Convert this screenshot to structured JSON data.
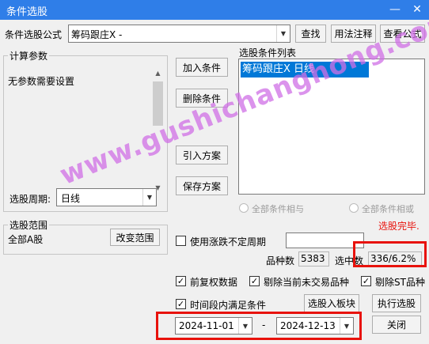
{
  "window": {
    "title": "条件选股",
    "minimize_glyph": "—",
    "close_glyph": "✕"
  },
  "formula": {
    "label": "条件选股公式",
    "value": "筹码跟庄X  -",
    "buttons": {
      "find": "查找",
      "usage": "用法注释",
      "view": "查看公式"
    }
  },
  "params": {
    "group_label": "计算参数",
    "text": "无参数需要设置",
    "period_label": "选股周期:",
    "period_value": "日线"
  },
  "middle_buttons": {
    "add": "加入条件",
    "delete": "删除条件",
    "import": "引入方案",
    "save": "保存方案"
  },
  "conditions": {
    "label": "选股条件列表",
    "items": [
      "筹码跟庄X  日线"
    ],
    "radio_and": "全部条件相与",
    "radio_or": "全部条件相或",
    "status": "选股完毕."
  },
  "range": {
    "group_label": "选股范围",
    "value": "全部A股",
    "change_button": "改变范围"
  },
  "options": {
    "limit_up": "使用涨跌不定周期",
    "count_label": "品种数",
    "count_value": "5383",
    "selected_label": "选中数",
    "selected_value": "336/6.2%",
    "fq": "前复权数据",
    "exclude_untraded": "剔除当前未交易品种",
    "exclude_st": "剔除ST品种",
    "period_satisfy": "时间段内满足条件",
    "select_to_block": "选股入板块",
    "execute": "执行选股",
    "date_from": "2024-11-01",
    "date_sep": "-",
    "date_to": "2024-12-13",
    "close": "关闭"
  },
  "watermark": "www.gushichanghong.com",
  "colors": {
    "titlebar": "#2f7ee8",
    "selection": "#0078d7",
    "status_red": "#e8120c",
    "highlight_box": "#e8120c",
    "watermark": "#d06fe6"
  }
}
